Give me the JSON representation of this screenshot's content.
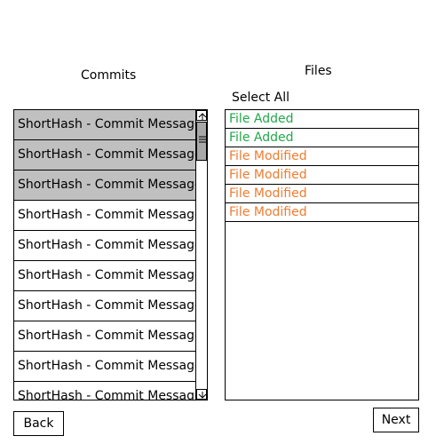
{
  "commits": {
    "heading": "Commits",
    "items": [
      {
        "label": "ShortHash - Commit Message",
        "selected": true
      },
      {
        "label": "ShortHash - Commit Message",
        "selected": true
      },
      {
        "label": "ShortHash - Commit Message",
        "selected": true
      },
      {
        "label": "ShortHash - Commit Message",
        "selected": false
      },
      {
        "label": "ShortHash - Commit Message",
        "selected": false
      },
      {
        "label": "ShortHash - Commit Message",
        "selected": false
      },
      {
        "label": "ShortHash - Commit Message",
        "selected": false
      },
      {
        "label": "ShortHash - Commit Message",
        "selected": false
      },
      {
        "label": "ShortHash - Commit Message",
        "selected": false
      },
      {
        "label": "ShortHash - Commit Message",
        "selected": false
      }
    ]
  },
  "files": {
    "heading": "Files",
    "select_all_label": "Select All",
    "items": [
      {
        "label": "File Added",
        "status": "added"
      },
      {
        "label": "File Added",
        "status": "added"
      },
      {
        "label": "File Modified",
        "status": "modified"
      },
      {
        "label": "File Modified",
        "status": "modified"
      },
      {
        "label": "File Modified",
        "status": "modified"
      },
      {
        "label": "File Modified",
        "status": "modified"
      }
    ]
  },
  "colors": {
    "added": "#22a84a",
    "modified": "#ed7d31",
    "selected_row": "#c0c0c0"
  },
  "buttons": {
    "back_label": "Back",
    "next_label": "Next"
  }
}
